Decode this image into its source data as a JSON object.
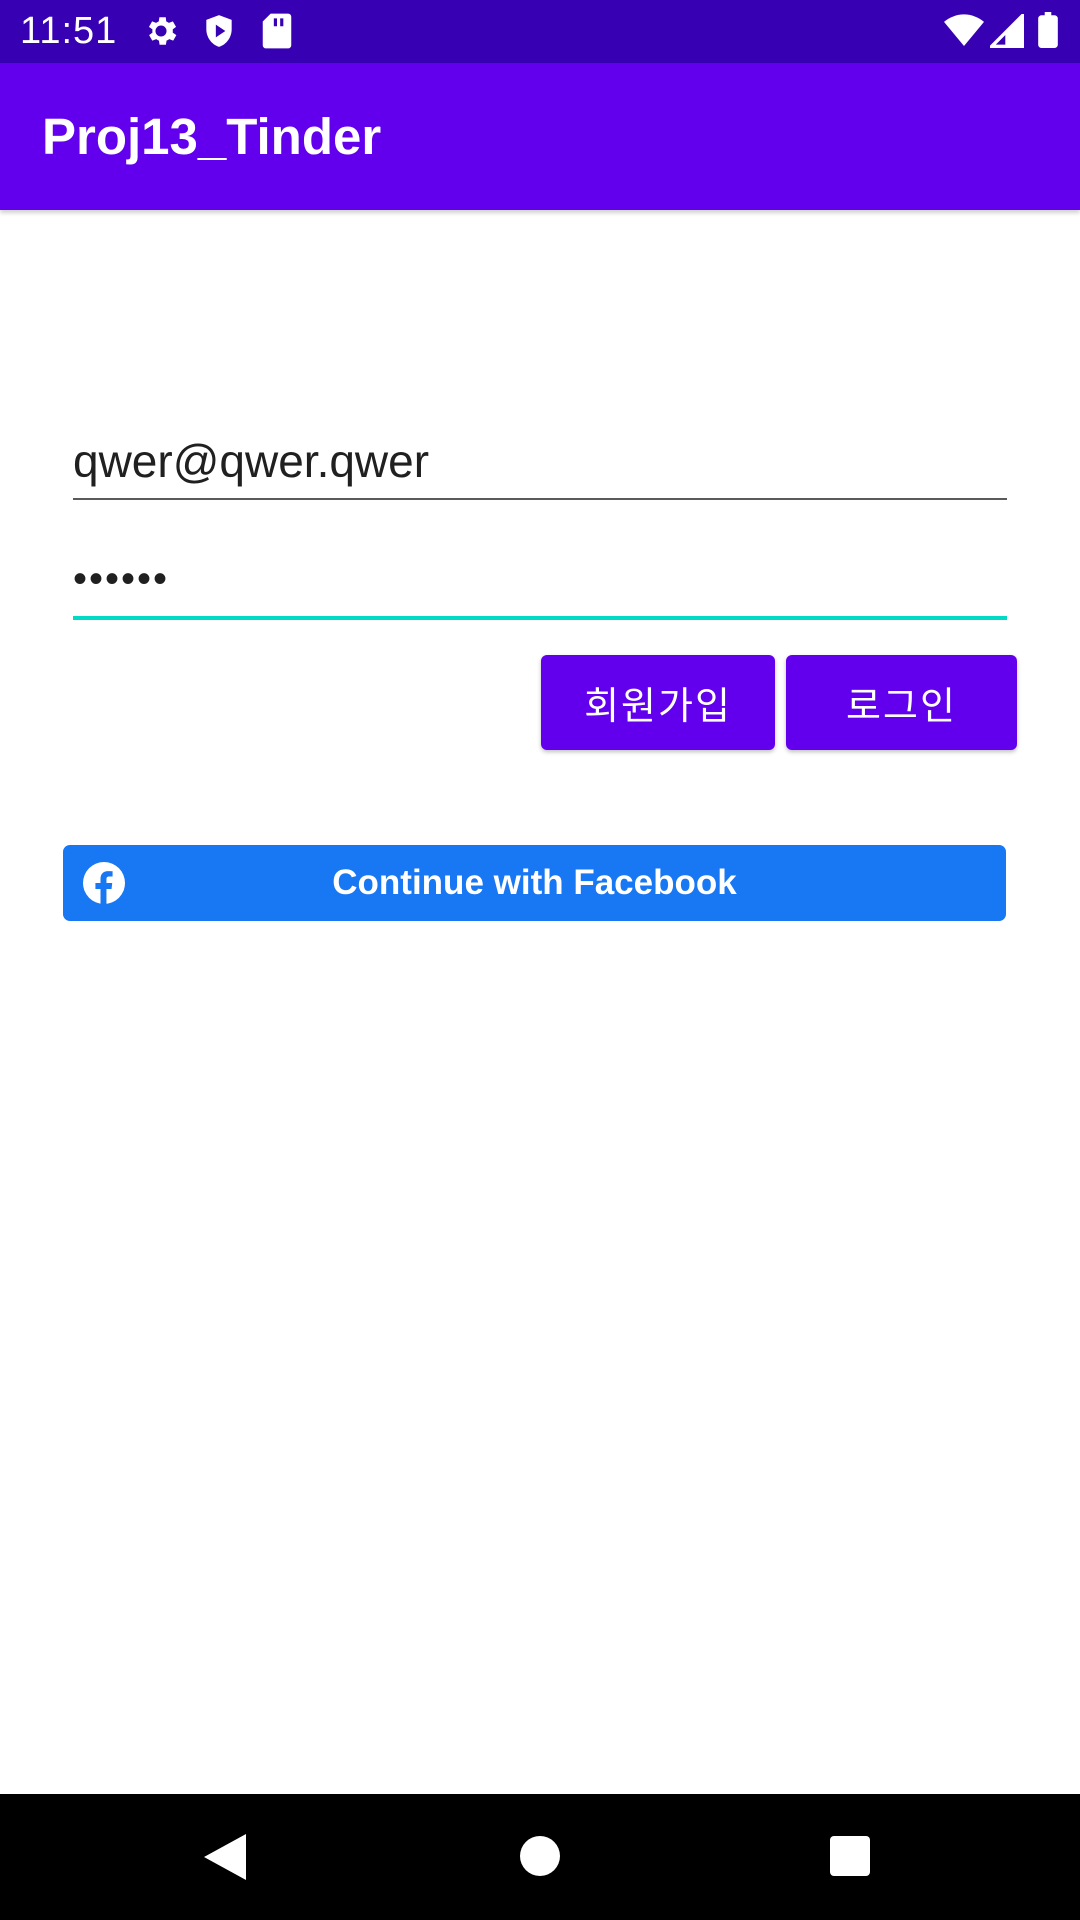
{
  "status_bar": {
    "time": "11:51",
    "left_icons": [
      "gear-icon",
      "shield-play-icon",
      "sd-card-icon"
    ],
    "right_icons": [
      "wifi-icon",
      "signal-icon",
      "battery-icon"
    ]
  },
  "app_bar": {
    "title": "Proj13_Tinder"
  },
  "login_form": {
    "email_value": "qwer@qwer.qwer",
    "password_value": "••••••",
    "signup_label": "회원가입",
    "login_label": "로그인"
  },
  "facebook": {
    "label": "Continue with Facebook",
    "icon": "facebook-icon"
  },
  "nav_bar": {
    "icons": [
      "back-icon",
      "home-icon",
      "recents-icon"
    ]
  },
  "colors": {
    "status_bar": "#3700b3",
    "primary": "#6200ee",
    "accent": "#03dac5",
    "facebook": "#1877f2"
  }
}
